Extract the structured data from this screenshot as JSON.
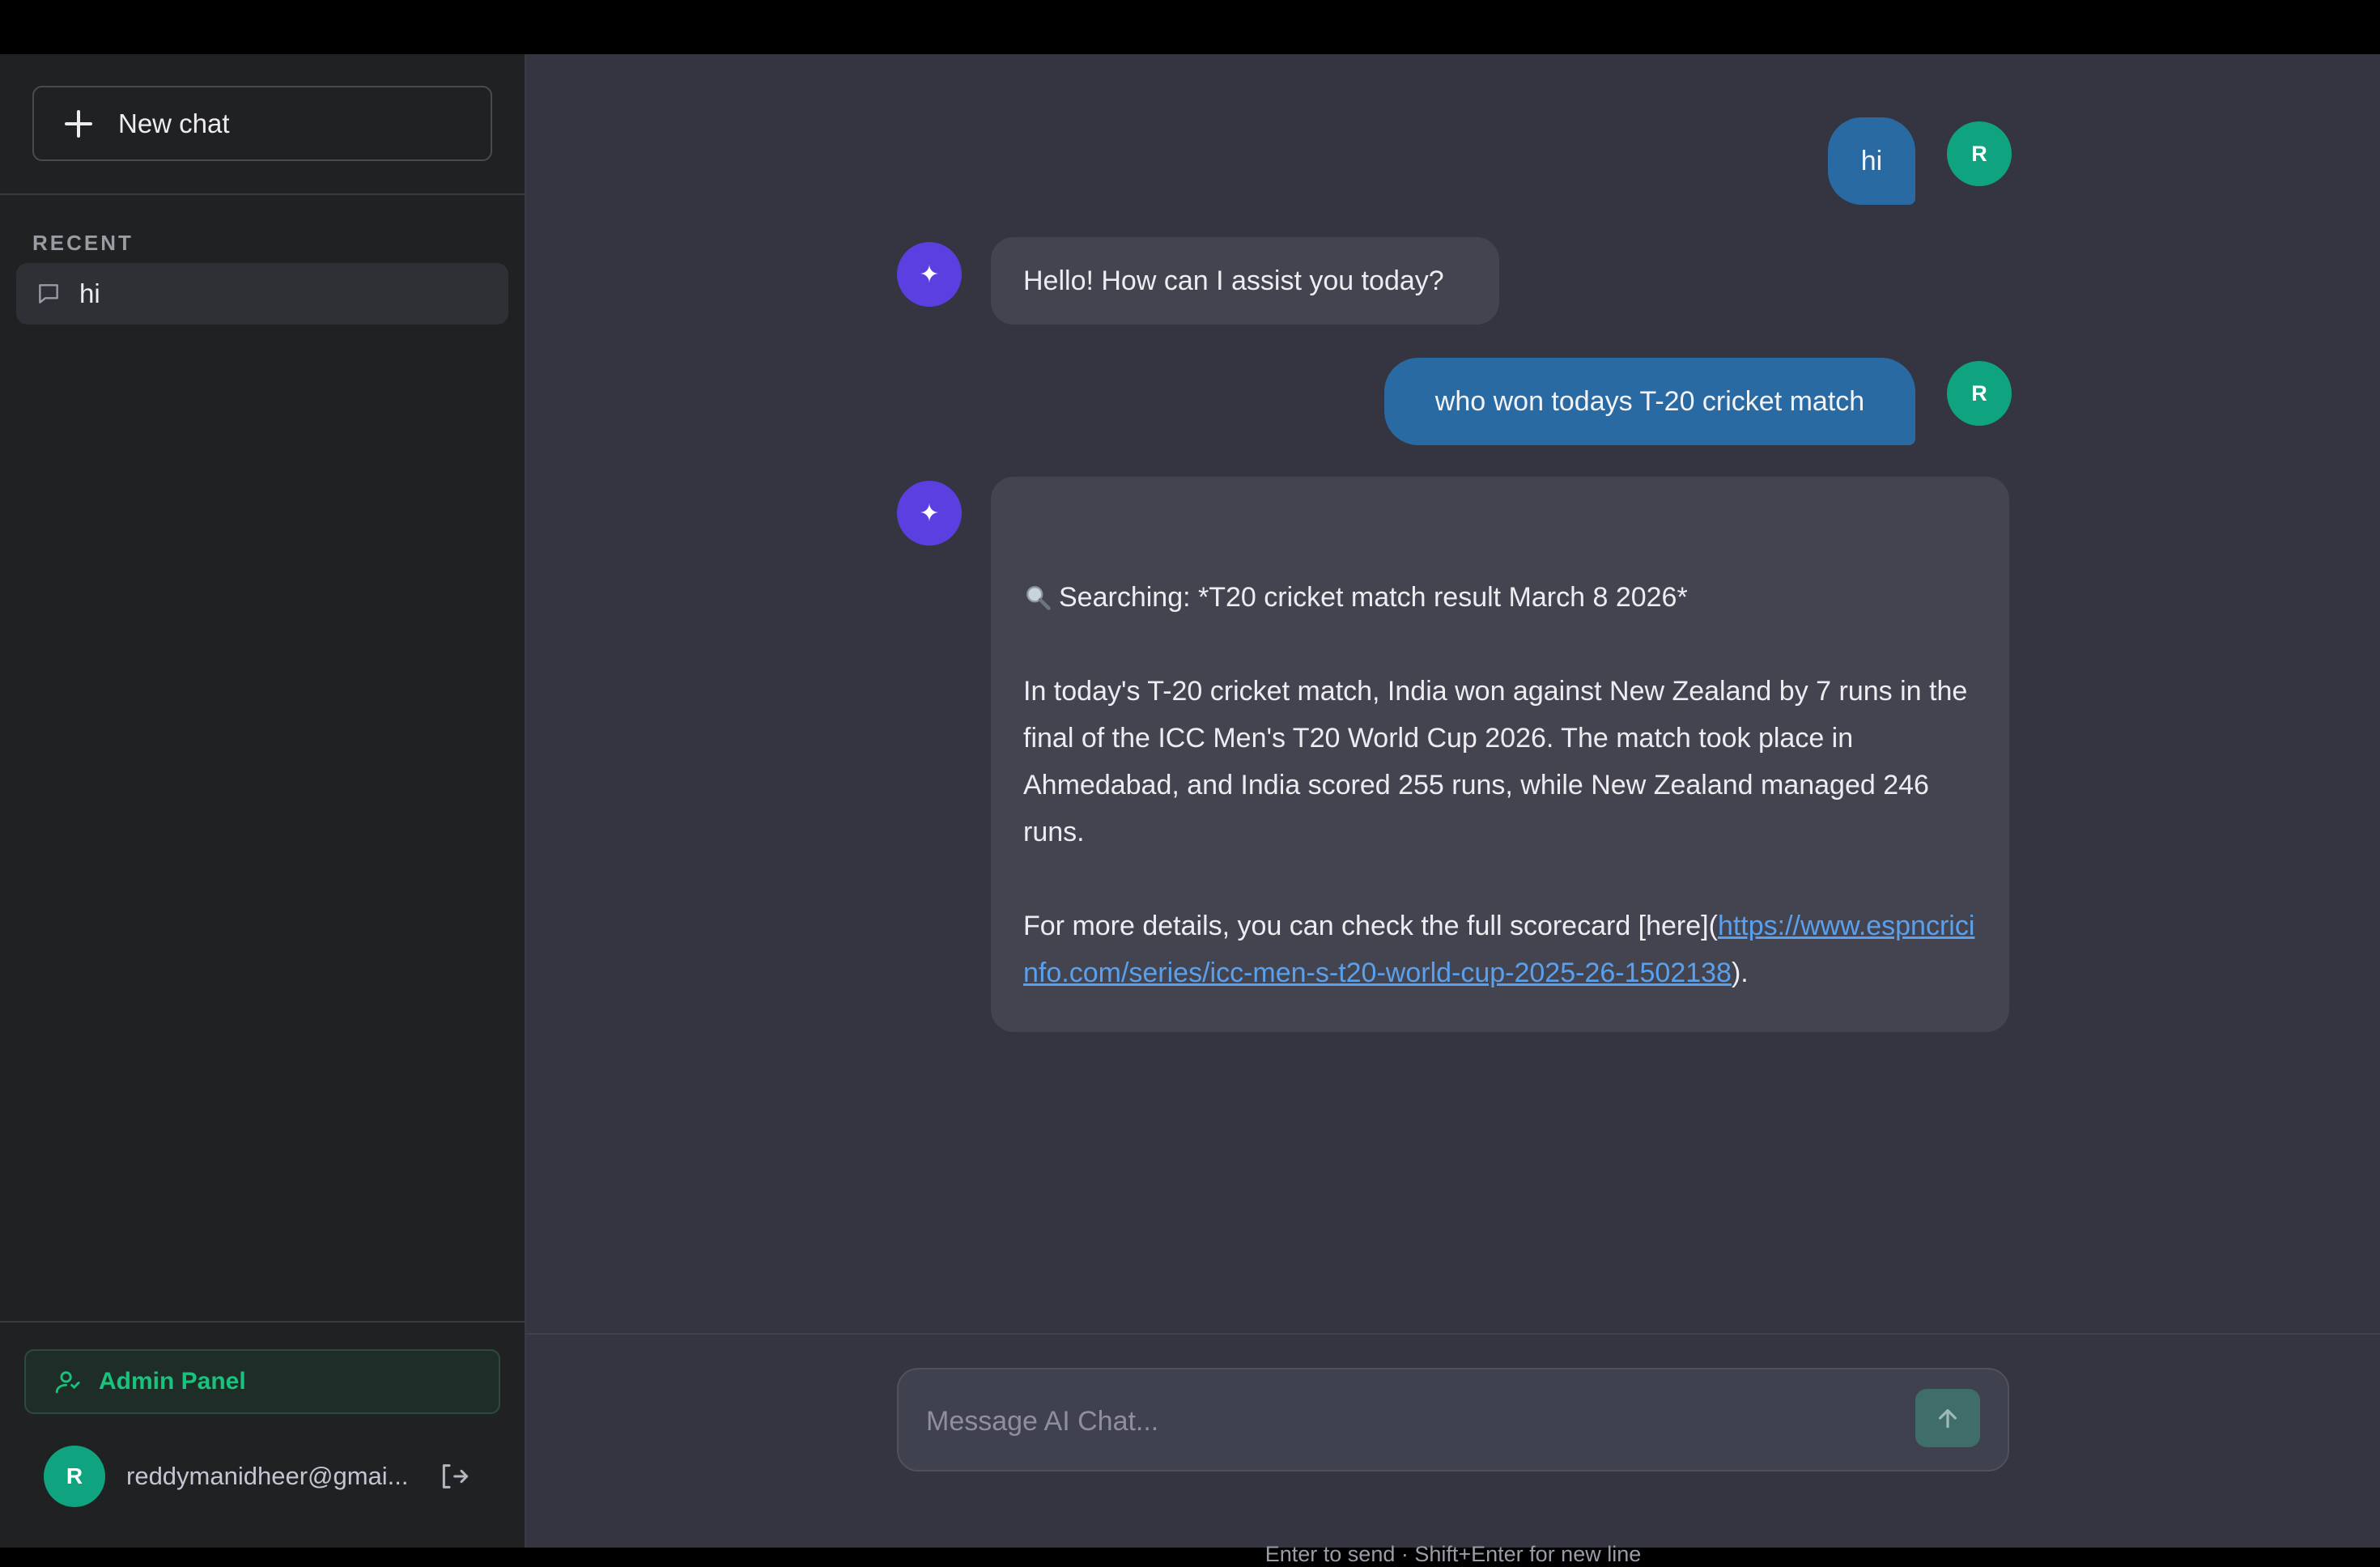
{
  "sidebar": {
    "new_chat_label": "New chat",
    "recent_label": "RECENT",
    "chats": [
      {
        "label": "hi"
      }
    ],
    "admin_label": "Admin Panel",
    "user": {
      "initial": "R",
      "email": "reddymanidheer@gmai..."
    }
  },
  "conversation": [
    {
      "role": "user",
      "avatar": "R",
      "text": "hi"
    },
    {
      "role": "assistant",
      "avatar_icon": "sparkle-icon",
      "text": "Hello! How can I assist you today?"
    },
    {
      "role": "user",
      "avatar": "R",
      "text": "who won todays T-20 cricket match"
    },
    {
      "role": "assistant",
      "avatar_icon": "sparkle-icon",
      "search_icon": "magnifier-icon",
      "search_line": "Searching: *T20 cricket match result March 8 2026*",
      "answer_paragraph": "In today's T-20 cricket match, India won against New Zealand by 7 runs in the final of the ICC Men's T20 World Cup 2026. The match took place in Ahmedabad, and India scored 255 runs, while New Zealand managed 246 runs.",
      "details_prefix": "For more details, you can check the full scorecard [here](",
      "details_link": "https://www.espncricinfo.com/series/icc-men-s-t20-world-cup-2025-26-1502138",
      "details_suffix": ")."
    }
  ],
  "composer": {
    "placeholder": "Message AI Chat...",
    "hint": "Enter to send · Shift+Enter for new line"
  },
  "colors": {
    "accent_green": "#10a37f",
    "user_bubble": "#2a6aa3",
    "assistant_avatar": "#5b3fe0",
    "link": "#5aa0ec"
  }
}
